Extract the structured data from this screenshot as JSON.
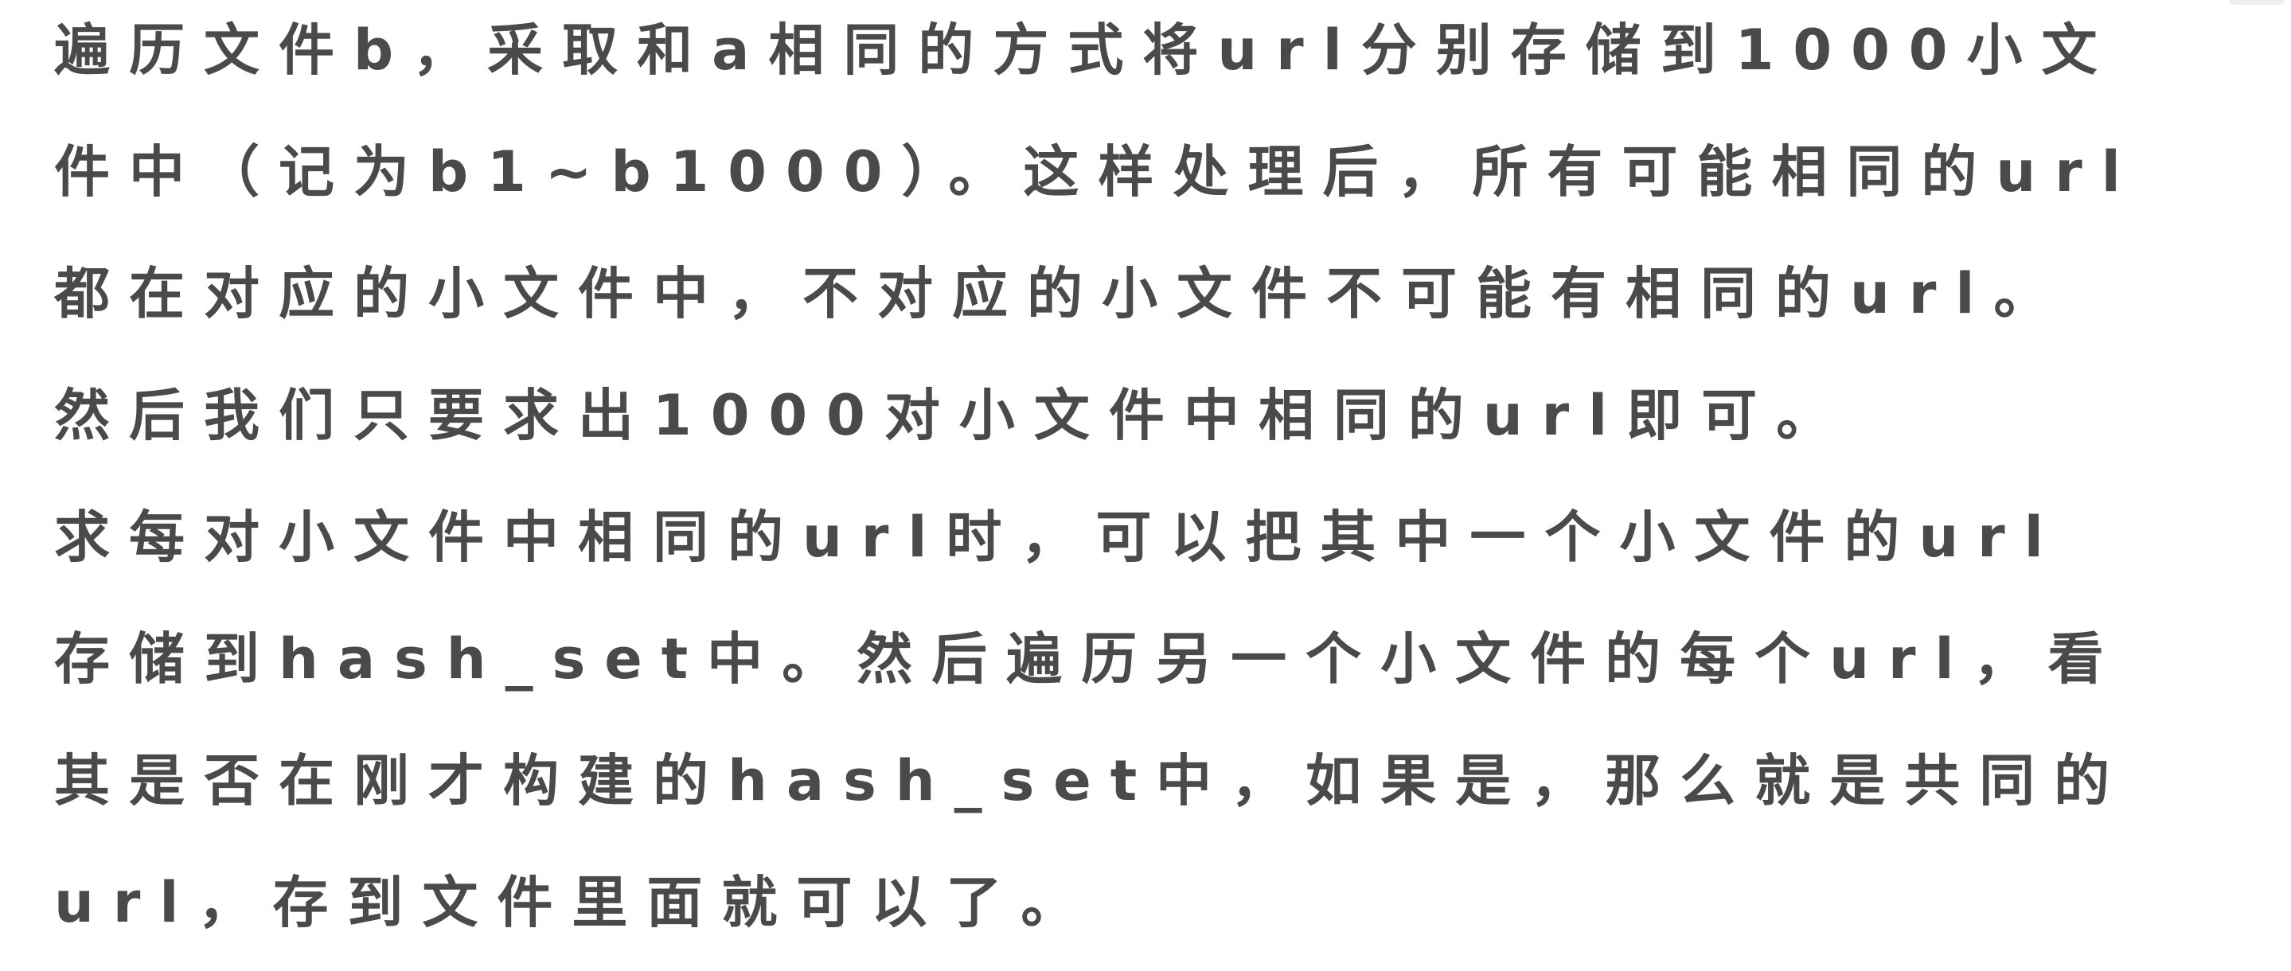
{
  "document": {
    "lines": [
      "遍历文件b，采取和a相同的方式将url分别存储到1000小文",
      "件中（记为b1~b1000）。这样处理后，所有可能相同的url",
      "都在对应的小文件中，不对应的小文件不可能有相同的url。",
      "然后我们只要求出1000对小文件中相同的url即可。",
      "求每对小文件中相同的url时，可以把其中一个小文件的url",
      "存储到hash_set中。然后遍历另一个小文件的每个url，看",
      "其是否在刚才构建的hash_set中，如果是，那么就是共同的",
      "url，存到文件里面就可以了。"
    ]
  }
}
